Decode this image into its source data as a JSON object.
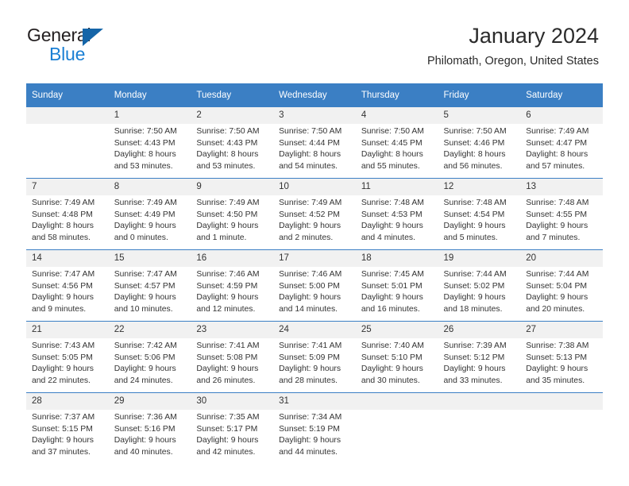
{
  "brand": {
    "name_part1": "General",
    "name_part2": "Blue",
    "triangle_color": "#1565a8",
    "blue_color": "#1a7fd4"
  },
  "header": {
    "title": "January 2024",
    "subtitle": "Philomath, Oregon, United States"
  },
  "theme": {
    "header_bg": "#3b7fc4",
    "header_text": "#ffffff",
    "daynum_bg": "#f1f1f1",
    "divider": "#3b7fc4",
    "body_text": "#333333"
  },
  "weekday_headers": [
    "Sunday",
    "Monday",
    "Tuesday",
    "Wednesday",
    "Thursday",
    "Friday",
    "Saturday"
  ],
  "labels": {
    "sunrise_prefix": "Sunrise: ",
    "sunset_prefix": "Sunset: ",
    "daylight_prefix": "Daylight: "
  },
  "weeks": [
    [
      {
        "day": "",
        "blank": true
      },
      {
        "day": "1",
        "sunrise": "Sunrise: 7:50 AM",
        "sunset": "Sunset: 4:43 PM",
        "daylight1": "Daylight: 8 hours",
        "daylight2": "and 53 minutes."
      },
      {
        "day": "2",
        "sunrise": "Sunrise: 7:50 AM",
        "sunset": "Sunset: 4:43 PM",
        "daylight1": "Daylight: 8 hours",
        "daylight2": "and 53 minutes."
      },
      {
        "day": "3",
        "sunrise": "Sunrise: 7:50 AM",
        "sunset": "Sunset: 4:44 PM",
        "daylight1": "Daylight: 8 hours",
        "daylight2": "and 54 minutes."
      },
      {
        "day": "4",
        "sunrise": "Sunrise: 7:50 AM",
        "sunset": "Sunset: 4:45 PM",
        "daylight1": "Daylight: 8 hours",
        "daylight2": "and 55 minutes."
      },
      {
        "day": "5",
        "sunrise": "Sunrise: 7:50 AM",
        "sunset": "Sunset: 4:46 PM",
        "daylight1": "Daylight: 8 hours",
        "daylight2": "and 56 minutes."
      },
      {
        "day": "6",
        "sunrise": "Sunrise: 7:49 AM",
        "sunset": "Sunset: 4:47 PM",
        "daylight1": "Daylight: 8 hours",
        "daylight2": "and 57 minutes."
      }
    ],
    [
      {
        "day": "7",
        "sunrise": "Sunrise: 7:49 AM",
        "sunset": "Sunset: 4:48 PM",
        "daylight1": "Daylight: 8 hours",
        "daylight2": "and 58 minutes."
      },
      {
        "day": "8",
        "sunrise": "Sunrise: 7:49 AM",
        "sunset": "Sunset: 4:49 PM",
        "daylight1": "Daylight: 9 hours",
        "daylight2": "and 0 minutes."
      },
      {
        "day": "9",
        "sunrise": "Sunrise: 7:49 AM",
        "sunset": "Sunset: 4:50 PM",
        "daylight1": "Daylight: 9 hours",
        "daylight2": "and 1 minute."
      },
      {
        "day": "10",
        "sunrise": "Sunrise: 7:49 AM",
        "sunset": "Sunset: 4:52 PM",
        "daylight1": "Daylight: 9 hours",
        "daylight2": "and 2 minutes."
      },
      {
        "day": "11",
        "sunrise": "Sunrise: 7:48 AM",
        "sunset": "Sunset: 4:53 PM",
        "daylight1": "Daylight: 9 hours",
        "daylight2": "and 4 minutes."
      },
      {
        "day": "12",
        "sunrise": "Sunrise: 7:48 AM",
        "sunset": "Sunset: 4:54 PM",
        "daylight1": "Daylight: 9 hours",
        "daylight2": "and 5 minutes."
      },
      {
        "day": "13",
        "sunrise": "Sunrise: 7:48 AM",
        "sunset": "Sunset: 4:55 PM",
        "daylight1": "Daylight: 9 hours",
        "daylight2": "and 7 minutes."
      }
    ],
    [
      {
        "day": "14",
        "sunrise": "Sunrise: 7:47 AM",
        "sunset": "Sunset: 4:56 PM",
        "daylight1": "Daylight: 9 hours",
        "daylight2": "and 9 minutes."
      },
      {
        "day": "15",
        "sunrise": "Sunrise: 7:47 AM",
        "sunset": "Sunset: 4:57 PM",
        "daylight1": "Daylight: 9 hours",
        "daylight2": "and 10 minutes."
      },
      {
        "day": "16",
        "sunrise": "Sunrise: 7:46 AM",
        "sunset": "Sunset: 4:59 PM",
        "daylight1": "Daylight: 9 hours",
        "daylight2": "and 12 minutes."
      },
      {
        "day": "17",
        "sunrise": "Sunrise: 7:46 AM",
        "sunset": "Sunset: 5:00 PM",
        "daylight1": "Daylight: 9 hours",
        "daylight2": "and 14 minutes."
      },
      {
        "day": "18",
        "sunrise": "Sunrise: 7:45 AM",
        "sunset": "Sunset: 5:01 PM",
        "daylight1": "Daylight: 9 hours",
        "daylight2": "and 16 minutes."
      },
      {
        "day": "19",
        "sunrise": "Sunrise: 7:44 AM",
        "sunset": "Sunset: 5:02 PM",
        "daylight1": "Daylight: 9 hours",
        "daylight2": "and 18 minutes."
      },
      {
        "day": "20",
        "sunrise": "Sunrise: 7:44 AM",
        "sunset": "Sunset: 5:04 PM",
        "daylight1": "Daylight: 9 hours",
        "daylight2": "and 20 minutes."
      }
    ],
    [
      {
        "day": "21",
        "sunrise": "Sunrise: 7:43 AM",
        "sunset": "Sunset: 5:05 PM",
        "daylight1": "Daylight: 9 hours",
        "daylight2": "and 22 minutes."
      },
      {
        "day": "22",
        "sunrise": "Sunrise: 7:42 AM",
        "sunset": "Sunset: 5:06 PM",
        "daylight1": "Daylight: 9 hours",
        "daylight2": "and 24 minutes."
      },
      {
        "day": "23",
        "sunrise": "Sunrise: 7:41 AM",
        "sunset": "Sunset: 5:08 PM",
        "daylight1": "Daylight: 9 hours",
        "daylight2": "and 26 minutes."
      },
      {
        "day": "24",
        "sunrise": "Sunrise: 7:41 AM",
        "sunset": "Sunset: 5:09 PM",
        "daylight1": "Daylight: 9 hours",
        "daylight2": "and 28 minutes."
      },
      {
        "day": "25",
        "sunrise": "Sunrise: 7:40 AM",
        "sunset": "Sunset: 5:10 PM",
        "daylight1": "Daylight: 9 hours",
        "daylight2": "and 30 minutes."
      },
      {
        "day": "26",
        "sunrise": "Sunrise: 7:39 AM",
        "sunset": "Sunset: 5:12 PM",
        "daylight1": "Daylight: 9 hours",
        "daylight2": "and 33 minutes."
      },
      {
        "day": "27",
        "sunrise": "Sunrise: 7:38 AM",
        "sunset": "Sunset: 5:13 PM",
        "daylight1": "Daylight: 9 hours",
        "daylight2": "and 35 minutes."
      }
    ],
    [
      {
        "day": "28",
        "sunrise": "Sunrise: 7:37 AM",
        "sunset": "Sunset: 5:15 PM",
        "daylight1": "Daylight: 9 hours",
        "daylight2": "and 37 minutes."
      },
      {
        "day": "29",
        "sunrise": "Sunrise: 7:36 AM",
        "sunset": "Sunset: 5:16 PM",
        "daylight1": "Daylight: 9 hours",
        "daylight2": "and 40 minutes."
      },
      {
        "day": "30",
        "sunrise": "Sunrise: 7:35 AM",
        "sunset": "Sunset: 5:17 PM",
        "daylight1": "Daylight: 9 hours",
        "daylight2": "and 42 minutes."
      },
      {
        "day": "31",
        "sunrise": "Sunrise: 7:34 AM",
        "sunset": "Sunset: 5:19 PM",
        "daylight1": "Daylight: 9 hours",
        "daylight2": "and 44 minutes."
      },
      {
        "day": "",
        "blank": true
      },
      {
        "day": "",
        "blank": true
      },
      {
        "day": "",
        "blank": true
      }
    ]
  ]
}
